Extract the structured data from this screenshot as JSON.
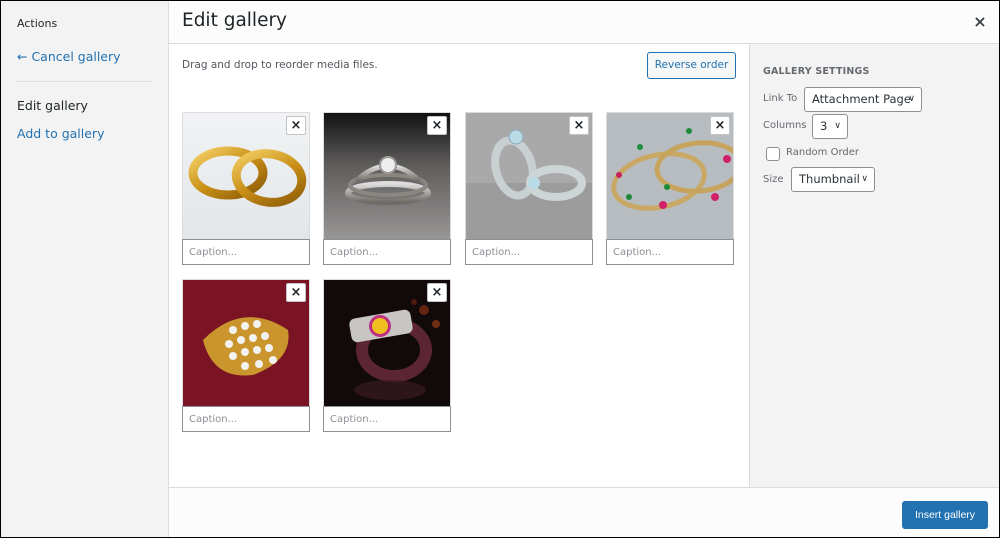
{
  "sidebar": {
    "heading": "Actions",
    "cancel_link": "← Cancel gallery",
    "active_item": "Edit gallery",
    "add_link": "Add to gallery"
  },
  "header": {
    "title": "Edit gallery",
    "close_icon": "×"
  },
  "main": {
    "instructions": "Drag and drop to reorder media files.",
    "reverse_order_label": "Reverse order",
    "items": [
      {
        "image": "gold-wedding-rings",
        "caption_placeholder": "Caption...",
        "caption_value": ""
      },
      {
        "image": "diamond-ring-set-dark",
        "caption_placeholder": "Caption...",
        "caption_value": ""
      },
      {
        "image": "silver-rings-render",
        "caption_placeholder": "Caption...",
        "caption_value": ""
      },
      {
        "image": "gemstone-bangles",
        "caption_placeholder": "Caption...",
        "caption_value": ""
      },
      {
        "image": "gold-diamond-ring-red",
        "caption_placeholder": "Caption...",
        "caption_value": ""
      },
      {
        "image": "yellow-gem-ring-dark",
        "caption_placeholder": "Caption...",
        "caption_value": ""
      }
    ],
    "remove_icon": "×"
  },
  "settings": {
    "heading": "GALLERY SETTINGS",
    "link_to_label": "Link To",
    "link_to_value": "Attachment Page",
    "columns_label": "Columns",
    "columns_value": "3",
    "random_order_label": "Random Order",
    "random_order_checked": false,
    "size_label": "Size",
    "size_value": "Thumbnail"
  },
  "footer": {
    "insert_label": "Insert gallery"
  }
}
